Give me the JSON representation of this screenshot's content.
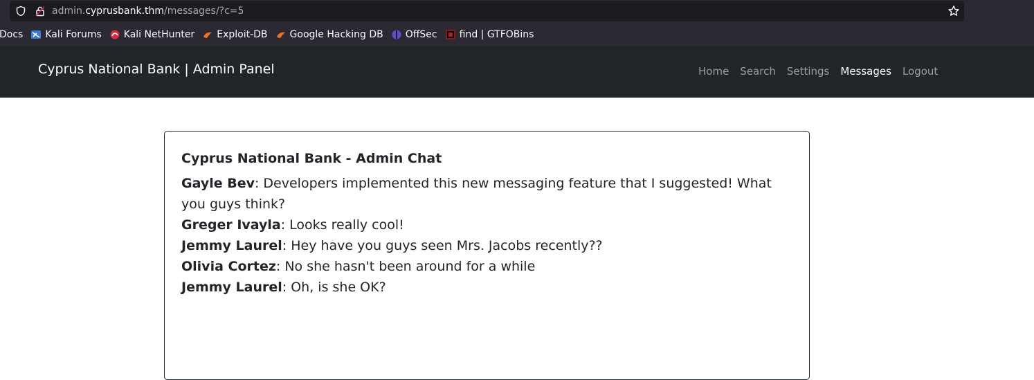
{
  "browser": {
    "url_prefix": "admin.",
    "url_host": "cyprusbank.thm",
    "url_path": "/messages/?c=5",
    "bookmarks": [
      {
        "label": "Docs",
        "icon": "none"
      },
      {
        "label": "Kali Forums",
        "icon": "kali-forums-icon"
      },
      {
        "label": "Kali NetHunter",
        "icon": "kali-nethunter-icon"
      },
      {
        "label": "Exploit-DB",
        "icon": "exploit-db-icon"
      },
      {
        "label": "Google Hacking DB",
        "icon": "ghdb-icon"
      },
      {
        "label": "OffSec",
        "icon": "offsec-icon"
      },
      {
        "label": "find | GTFOBins",
        "icon": "gtfobins-icon"
      }
    ]
  },
  "navbar": {
    "brand": "Cyprus National Bank | Admin Panel",
    "links": [
      {
        "label": "Home",
        "active": false
      },
      {
        "label": "Search",
        "active": false
      },
      {
        "label": "Settings",
        "active": false
      },
      {
        "label": "Messages",
        "active": true
      },
      {
        "label": "Logout",
        "active": false
      }
    ]
  },
  "chat": {
    "title": "Cyprus National Bank - Admin Chat",
    "messages": [
      {
        "author": "Gayle Bev",
        "text": ": Developers implemented this new messaging feature that I suggested! What you guys think?"
      },
      {
        "author": "Greger Ivayla",
        "text": ": Looks really cool!"
      },
      {
        "author": "Jemmy Laurel",
        "text": ": Hey have you guys seen Mrs. Jacobs recently??"
      },
      {
        "author": "Olivia Cortez",
        "text": ": No she hasn't been around for a while"
      },
      {
        "author": "Jemmy Laurel",
        "text": ": Oh, is she OK?"
      }
    ]
  },
  "colors": {
    "chrome_bg": "#2b2a33",
    "urlbar_bg": "#1c1b22",
    "navbar_bg": "#212529",
    "text_dark": "#212529"
  }
}
